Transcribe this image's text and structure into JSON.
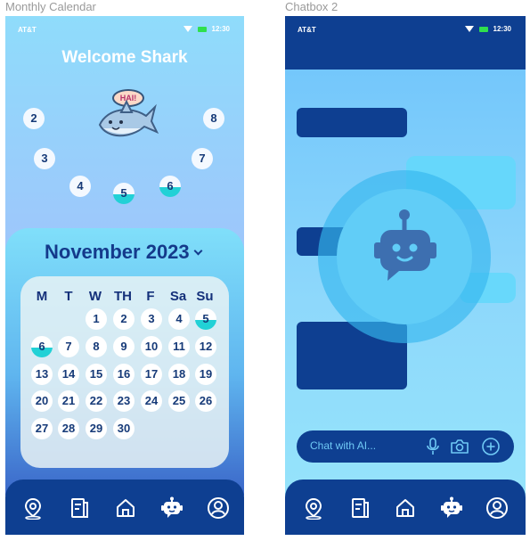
{
  "frames": {
    "left_label": "Monthly Calendar",
    "right_label": "Chatbox 2"
  },
  "status": {
    "carrier": "AT&T",
    "time": "12:30"
  },
  "calendar_screen": {
    "welcome": "Welcome Shark",
    "mascot_speech": "HAI!",
    "history_bubbles": [
      "2",
      "8",
      "3",
      "7",
      "4",
      "5",
      "6"
    ],
    "month": "November 2023",
    "weekdays": [
      "M",
      "T",
      "W",
      "TH",
      "F",
      "Sa",
      "Su"
    ],
    "days": [
      "1",
      "2",
      "3",
      "4",
      "5",
      "6",
      "7",
      "8",
      "9",
      "10",
      "11",
      "12",
      "13",
      "14",
      "15",
      "16",
      "17",
      "18",
      "19",
      "20",
      "21",
      "22",
      "23",
      "24",
      "25",
      "26",
      "27",
      "28",
      "29",
      "30"
    ]
  },
  "chat_screen": {
    "input_placeholder": "Chat with AI..."
  },
  "tabs": [
    "map-pin-icon",
    "notes-icon",
    "home-icon",
    "robot-icon",
    "profile-icon"
  ],
  "colors": {
    "navy": "#0e3f91",
    "water": "#22d1d6",
    "sky": "#8fdcfb"
  }
}
